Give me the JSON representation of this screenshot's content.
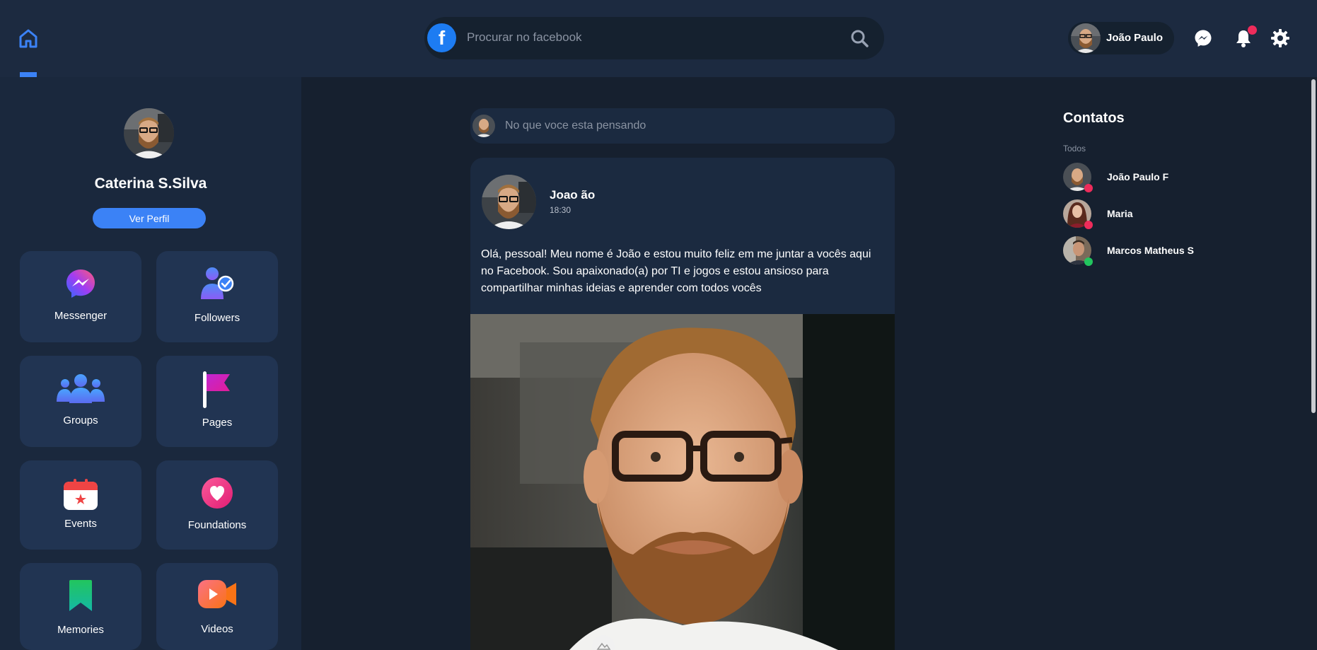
{
  "header": {
    "search_placeholder": "Procurar no facebook",
    "fb_logo_letter": "f",
    "user_name": "João Paulo",
    "icons": [
      "home-icon",
      "search-icon",
      "messenger-icon",
      "bell-icon",
      "gear-icon"
    ],
    "accent_color": "#3b82f6",
    "notification_color": "#ee2c5b"
  },
  "sidebar": {
    "profile_name": "Caterina S.Silva",
    "view_profile_label": "Ver Perfil",
    "tiles": [
      {
        "label": "Messenger",
        "icon": "messenger-icon"
      },
      {
        "label": "Followers",
        "icon": "followers-icon"
      },
      {
        "label": "Groups",
        "icon": "groups-icon"
      },
      {
        "label": "Pages",
        "icon": "flag-icon"
      },
      {
        "label": "Events",
        "icon": "calendar-icon"
      },
      {
        "label": "Foundations",
        "icon": "heart-icon"
      },
      {
        "label": "Memories",
        "icon": "bookmark-icon"
      },
      {
        "label": "Videos",
        "icon": "video-camera-icon"
      }
    ]
  },
  "feed": {
    "composer_placeholder": "No que voce esta pensando",
    "post": {
      "author": "Joao ão",
      "time": "18:30",
      "text": "Olá, pessoal! Meu nome é João e estou muito feliz em me juntar a vocês aqui no Facebook. Sou apaixonado(a) por TI e jogos e estou ansioso para compartilhar minhas ideias e aprender com todos vocês"
    }
  },
  "contacts": {
    "title": "Contatos",
    "filter": "Todos",
    "items": [
      {
        "name": "João Paulo F",
        "status_color": "#ee2c5b"
      },
      {
        "name": "Maria",
        "status_color": "#ee2c5b"
      },
      {
        "name": "Marcos Matheus S",
        "status_color": "#22c55e"
      }
    ]
  }
}
